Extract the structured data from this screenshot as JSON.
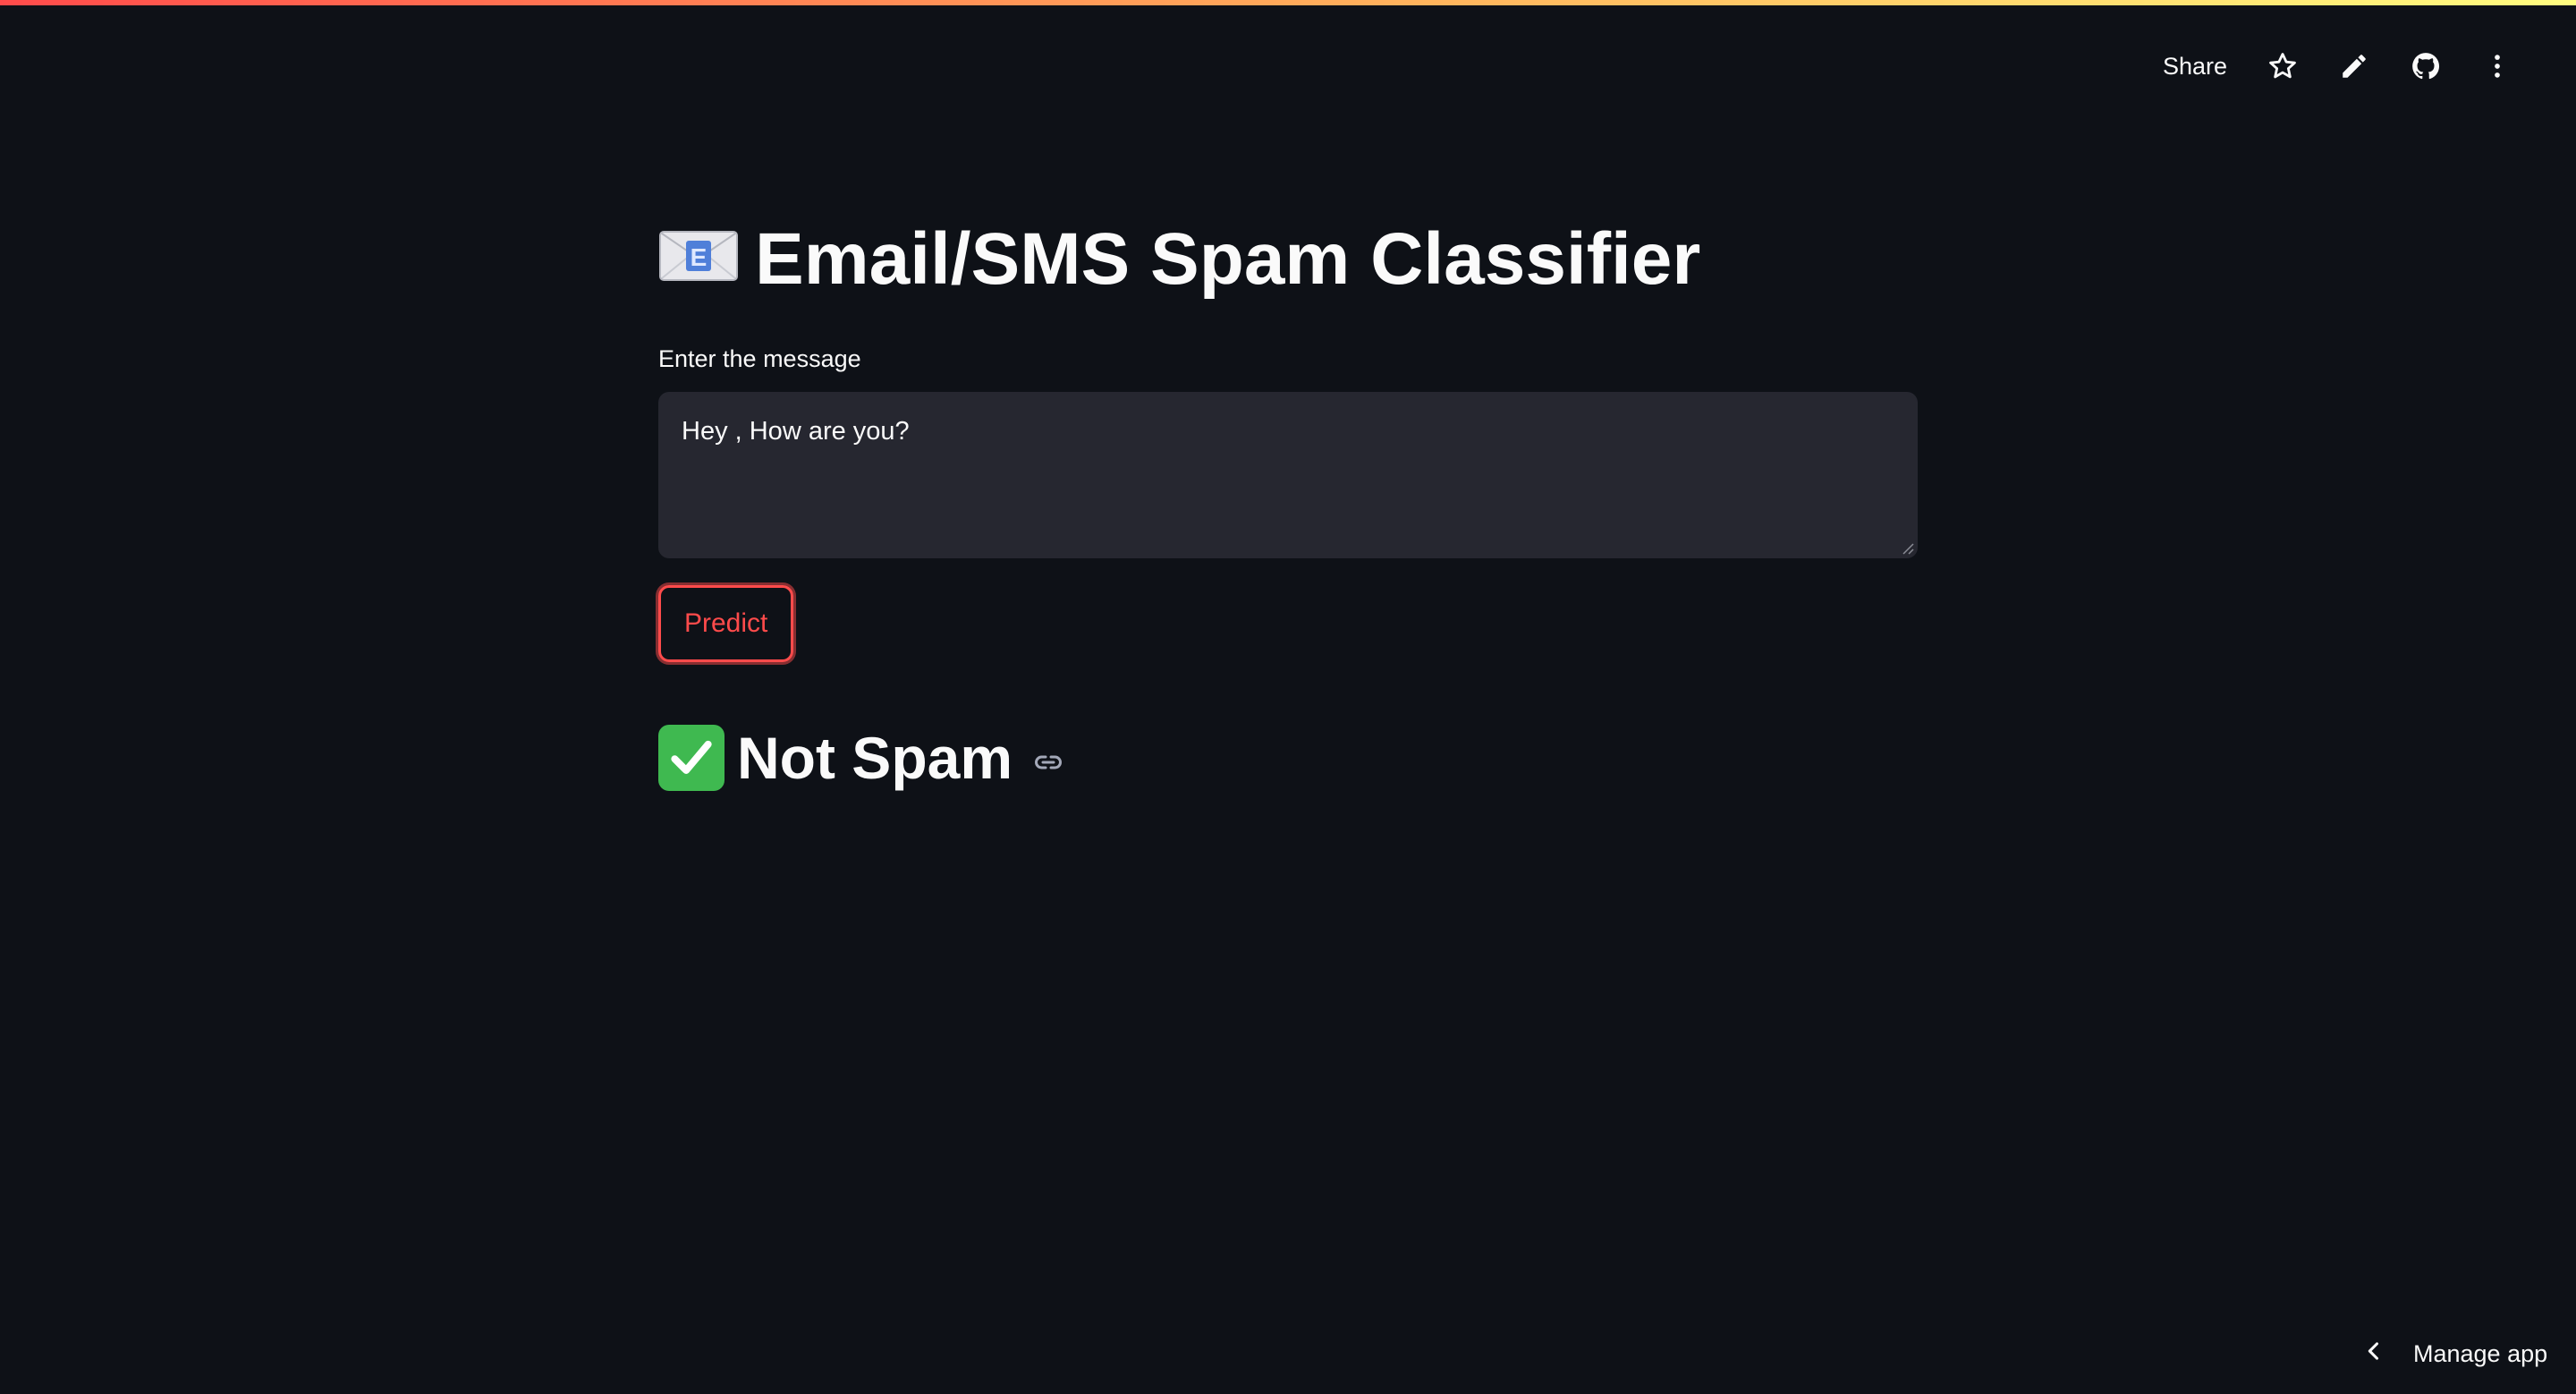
{
  "header": {
    "share_label": "Share",
    "icons": [
      "star-icon",
      "pencil-icon",
      "github-icon",
      "more-vertical-icon"
    ]
  },
  "main": {
    "title": "Email/SMS Spam Classifier",
    "input_label": "Enter the message",
    "input_value": "Hey , How are you?",
    "predict_label": "Predict",
    "result_text": "Not Spam"
  },
  "footer": {
    "manage_app_label": "Manage app"
  },
  "colors": {
    "background": "#0e1117",
    "input_bg": "#262730",
    "accent": "#ff4b4b",
    "success": "#3fb950"
  }
}
